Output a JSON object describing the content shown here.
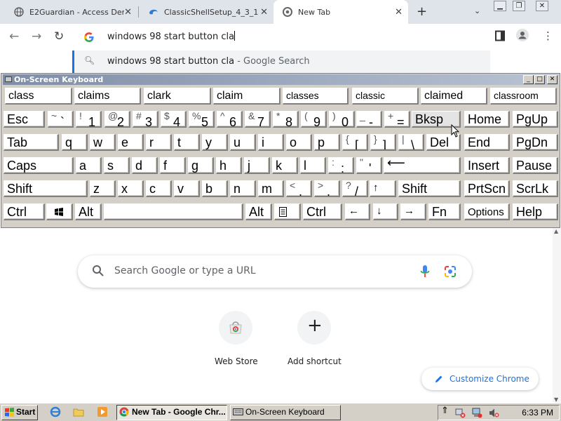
{
  "browser": {
    "tabs": [
      {
        "title": "E2Guardian - Access Deni",
        "active": false
      },
      {
        "title": "ClassicShellSetup_4_3_1",
        "active": false
      },
      {
        "title": "New Tab",
        "active": true
      }
    ],
    "new_tab_symbol": "+",
    "tab_search_symbol": "⌄",
    "omnibox": {
      "value": "windows 98 start button cla"
    },
    "suggestion": {
      "query": "windows 98 start button cla",
      "suffix": " - Google Search"
    }
  },
  "osk": {
    "title": "On-Screen Keyboard",
    "predictions": [
      "class",
      "claims",
      "clark",
      "claim",
      "classes",
      "classic",
      "claimed",
      "classroom"
    ],
    "row1": {
      "esc": "Esc",
      "symbols": [
        {
          "up": "~",
          "lo": "`"
        },
        {
          "up": "!",
          "lo": "1"
        },
        {
          "up": "@",
          "lo": "2"
        },
        {
          "up": "#",
          "lo": "3"
        },
        {
          "up": "$",
          "lo": "4"
        },
        {
          "up": "%",
          "lo": "5"
        },
        {
          "up": "^",
          "lo": "6"
        },
        {
          "up": "&",
          "lo": "7"
        },
        {
          "up": "*",
          "lo": "8"
        },
        {
          "up": "(",
          "lo": "9"
        },
        {
          "up": ")",
          "lo": "0"
        },
        {
          "up": "_",
          "lo": "-"
        },
        {
          "up": "+",
          "lo": "="
        }
      ],
      "bksp": "Bksp",
      "home": "Home",
      "pgup": "PgUp"
    },
    "row2": {
      "tab": "Tab",
      "letters": [
        "q",
        "w",
        "e",
        "r",
        "t",
        "y",
        "u",
        "i",
        "o",
        "p"
      ],
      "symbols": [
        {
          "up": "{",
          "lo": "["
        },
        {
          "up": "}",
          "lo": "]"
        },
        {
          "up": "|",
          "lo": "\\"
        }
      ],
      "del": "Del",
      "end": "End",
      "pgdn": "PgDn"
    },
    "row3": {
      "caps": "Caps",
      "letters": [
        "a",
        "s",
        "d",
        "f",
        "g",
        "h",
        "j",
        "k",
        "l"
      ],
      "symbols": [
        {
          "up": ":",
          "lo": ";"
        },
        {
          "up": "\"",
          "lo": "'"
        }
      ],
      "enter": "⟵",
      "insert": "Insert",
      "pause": "Pause"
    },
    "row4": {
      "shift_left": "Shift",
      "letters": [
        "z",
        "x",
        "c",
        "v",
        "b",
        "n",
        "m"
      ],
      "symbols": [
        {
          "up": "<",
          "lo": ","
        },
        {
          "up": ">",
          "lo": "."
        },
        {
          "up": "?",
          "lo": "/"
        }
      ],
      "up_arrow": "↑",
      "shift_right": "Shift",
      "prtscn": "PrtScn",
      "scrlk": "ScrLk"
    },
    "row5": {
      "ctrl_left": "Ctrl",
      "alt_left": "Alt",
      "alt_right": "Alt",
      "ctrl_right": "Ctrl",
      "left_arrow": "←",
      "down_arrow": "↓",
      "right_arrow": "→",
      "fn": "Fn",
      "options": "Options",
      "help": "Help"
    }
  },
  "ntp": {
    "search_placeholder": "Search Google or type a URL",
    "shortcuts": [
      {
        "label": "Web Store",
        "icon": "web-store-icon"
      },
      {
        "label": "Add shortcut",
        "icon": "plus-icon",
        "symbol": "+"
      }
    ],
    "customize_label": "Customize Chrome"
  },
  "taskbar": {
    "start_label": "Start",
    "windows": [
      {
        "label": "New Tab - Google Chr...",
        "active": true
      },
      {
        "label": "On-Screen Keyboard",
        "active": false
      }
    ],
    "clock": "6:33 PM"
  },
  "colors": {
    "chrome_frame": "#dfe3ea",
    "accent": "#1a73e8",
    "w98_face": "#d4d0c8",
    "osk_title": "#7f8da6"
  }
}
